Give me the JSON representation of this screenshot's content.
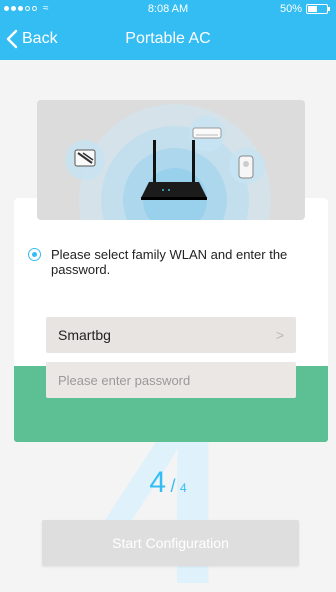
{
  "status_bar": {
    "time": "8:08 AM",
    "battery_percent_label": "50%",
    "battery_level": 0.5,
    "signal_bars_filled": 3,
    "signal_bars_total": 5
  },
  "nav": {
    "back_label": "Back",
    "title": "Portable AC"
  },
  "config": {
    "instruction": "Please select family WLAN and enter the password.",
    "selected_network": "Smartbg",
    "password_value": "",
    "password_placeholder": "Please enter password"
  },
  "step": {
    "current": "4",
    "separator": "/",
    "total": "4"
  },
  "actions": {
    "start_label": "Start Configuration"
  },
  "colors": {
    "accent": "#33bdf3",
    "card_green": "#5dbf94",
    "button_disabled": "#dedede"
  }
}
